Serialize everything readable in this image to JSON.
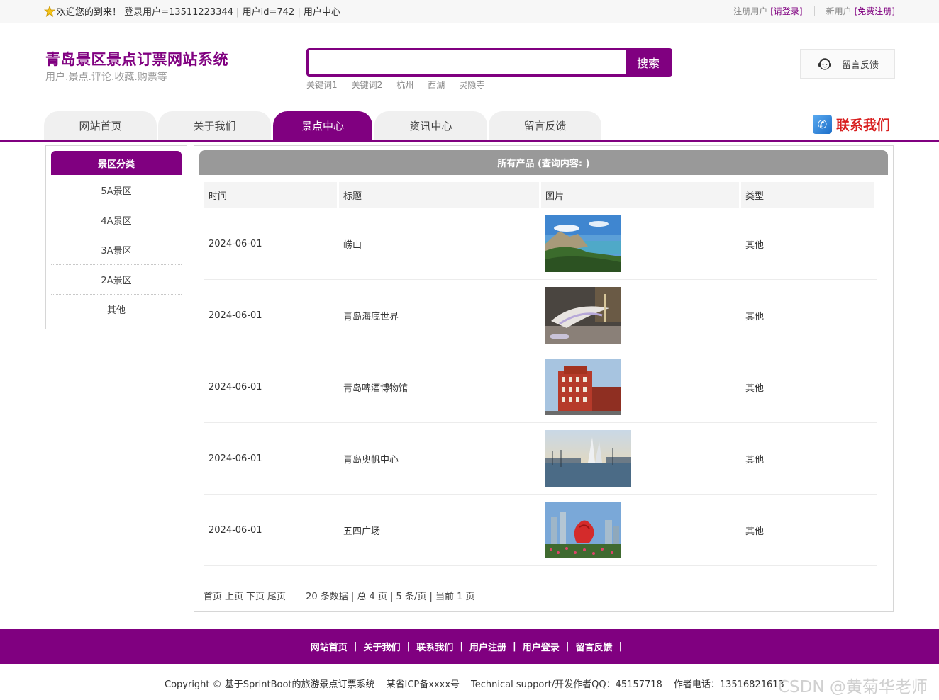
{
  "topbar": {
    "welcome": "欢迎您的到来！ 登录用户=13511223344 | 用户id=742 | 用户中心",
    "register_prefix": "注册用户",
    "login_link": "[请登录]",
    "new_user_prefix": "新用户",
    "register_link": "[免费注册]"
  },
  "header": {
    "title": "青岛景区景点订票网站系统",
    "subtitle": "用户.景点.评论.收藏.购票等",
    "search_placeholder": "",
    "search_button": "搜索",
    "keywords": [
      "关键词1",
      "关键词2",
      "杭州",
      "西湖",
      "灵隐寺"
    ],
    "feedback_label": "留言反馈"
  },
  "nav": {
    "items": [
      "网站首页",
      "关于我们",
      "景点中心",
      "资讯中心",
      "留言反馈"
    ],
    "active_index": 2,
    "contact_label": "联系我们"
  },
  "sidebar": {
    "title": "景区分类",
    "items": [
      "5A景区",
      "4A景区",
      "3A景区",
      "2A景区",
      "其他"
    ]
  },
  "main": {
    "title": "所有产品 (查询内容: )",
    "columns": [
      "时间",
      "标题",
      "图片",
      "类型"
    ],
    "rows": [
      {
        "time": "2024-06-01",
        "title": "崂山",
        "type": "其他",
        "image": "mountain-coast"
      },
      {
        "time": "2024-06-01",
        "title": "青岛海底世界",
        "type": "其他",
        "image": "aquarium-hall"
      },
      {
        "time": "2024-06-01",
        "title": "青岛啤酒博物馆",
        "type": "其他",
        "image": "red-building"
      },
      {
        "time": "2024-06-01",
        "title": "青岛奥帆中心",
        "type": "其他",
        "image": "marina-sails"
      },
      {
        "time": "2024-06-01",
        "title": "五四广场",
        "type": "其他",
        "image": "may-fourth-square"
      }
    ],
    "pager": {
      "first": "首页",
      "prev": "上页",
      "next": "下页",
      "last": "尾页",
      "summary": "20 条数据 | 总 4 页 | 5 条/页 | 当前 1 页"
    }
  },
  "footer": {
    "links": [
      "网站首页",
      "关于我们",
      "联系我们",
      "用户注册",
      "用户登录",
      "留言反馈"
    ],
    "separator": "|",
    "copyright": "Copyright © 基于SprintBoot的旅游景点订票系统",
    "icp": "某省ICP备xxxx号",
    "support": "Technical support/开发作者QQ：45157718",
    "phone": "作者电话：13516821613",
    "watermark": "CSDN @黄菊华老师"
  },
  "colors": {
    "brand": "#800080",
    "header_gray": "#999999",
    "contact_red": "#d81e1e"
  }
}
